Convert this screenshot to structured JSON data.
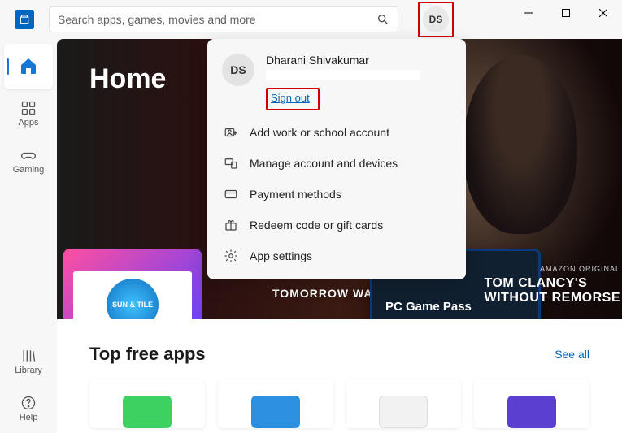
{
  "search": {
    "placeholder": "Search apps, games, movies and more"
  },
  "user": {
    "initials": "DS",
    "name": "Dharani Shivakumar",
    "signout": "Sign out"
  },
  "sidebar": {
    "items": [
      {
        "label": ""
      },
      {
        "label": "Apps"
      },
      {
        "label": "Gaming"
      }
    ],
    "library_label": "Library",
    "help_label": "Help"
  },
  "hero": {
    "title": "Home",
    "label_left": "TOMORROW WAR",
    "pass_title": "PC Game Pass",
    "right_tag": "AMAZON ORIGINAL",
    "right_title_a": "TOM CLANCY'S",
    "right_title_b": "WITHOUT REMORSE",
    "sun_badge": "SUN & TILE"
  },
  "section": {
    "title": "Top free apps",
    "see_all": "See all"
  },
  "flyout": {
    "items": [
      "Add work or school account",
      "Manage account and devices",
      "Payment methods",
      "Redeem code or gift cards",
      "App settings"
    ]
  }
}
